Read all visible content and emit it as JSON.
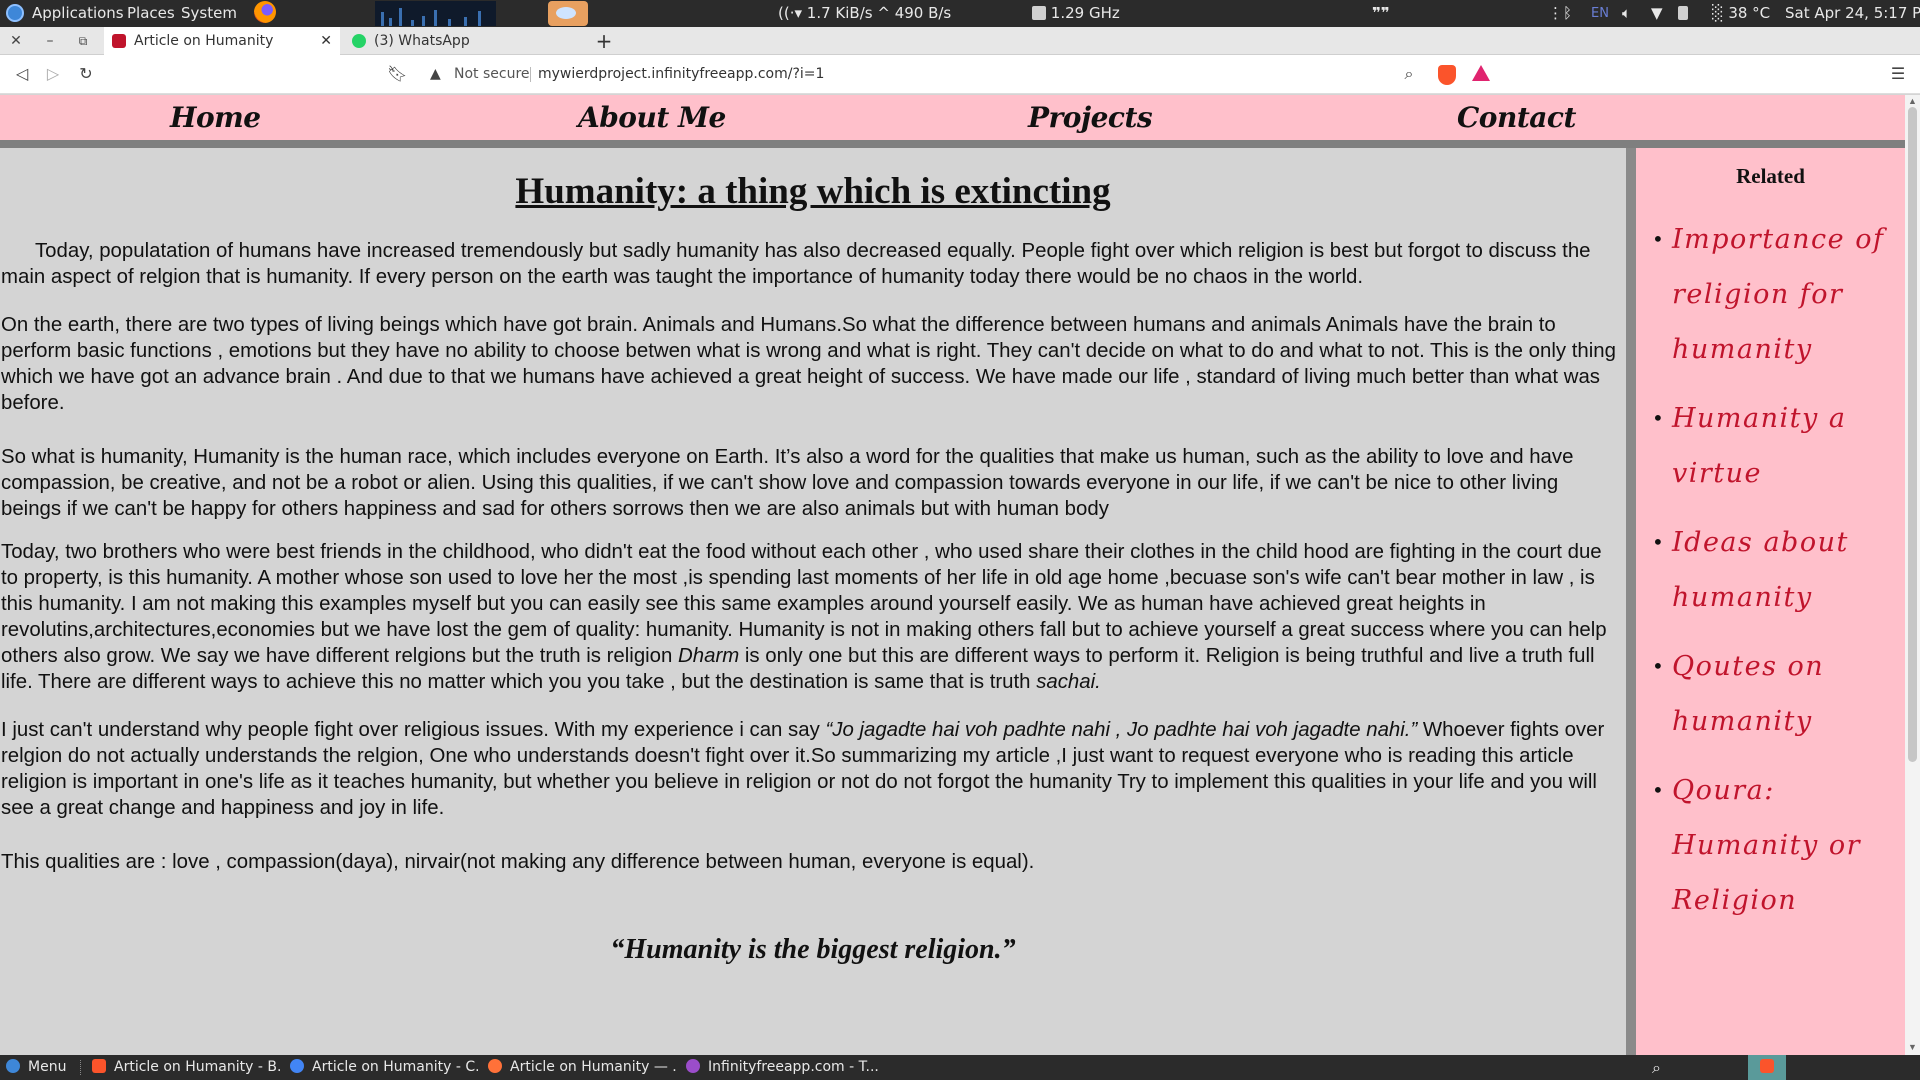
{
  "system_panel": {
    "menu_applications": "Applications",
    "menu_places": "Places",
    "menu_system": "System",
    "net_speed": "1.7 KiB/s ^ 490 B/s",
    "cpu_freq": "1.29 GHz",
    "keyboard_layout": "EN",
    "temperature": "38 °C",
    "clock": "Sat Apr 24,  5:17 PM"
  },
  "browser": {
    "tabs": [
      {
        "label": "Article on Humanity",
        "active": true,
        "favicon_color": "#c0142c"
      },
      {
        "label": "(3) WhatsApp",
        "active": false,
        "favicon_color": "#25d366"
      }
    ],
    "new_tab_label": "+",
    "security_label": "Not secure",
    "url": "mywierdproject.infinityfreeapp.com/?i=1"
  },
  "site_nav": {
    "items": [
      "Home",
      "About Me",
      "Projects",
      "Contact"
    ]
  },
  "article": {
    "title": "Humanity: a thing which is extincting",
    "paragraphs": [
      {
        "text": "      Today, populatation of humans have increased tremendously but sadly humanity has also decreased equally. People fight over which religion is best but forgot to discuss the main aspect of relgion that is humanity. If every person on the earth was taught the importance of humanity today there would be no chaos in the world."
      },
      {
        "text": "On the earth, there are two types of living beings which have got brain. Animals and Humans.So what the difference between humans and animals Animals have the brain to perform basic functions , emotions but they have no ability to choose betwen what is wrong and what is right. They can't decide on what to do and what to not. This is the only thing which we have got an advance brain . And due to that we humans have achieved a great height of success. We have made our life , standard of living much better than what was before."
      },
      {
        "text": "So what is humanity, Humanity is the human race, which includes everyone on Earth. It’s also a word for the qualities that make us human, such as the ability to love and have compassion, be creative, and not be a robot or alien. Using this qualities, if we can't show love and compassion towards everyone in our life, if we can't be nice to other living beings if we can't be happy for others happiness and sad for others sorrows then we are also animals but with human body"
      },
      {
        "part1": "Today, two brothers who were best friends in the childhood, who didn't eat the food without each other , who used share their clothes in the child hood are fighting in the court due to property, is this humanity. A mother whose son used to love her the most ,is spending last moments of her life in old age home ,becuase son's wife can't bear mother in law , is this humanity. I am not making this examples myself but you can easily see this same examples around yourself easily. We as human have achieved great heights in revolutins,architectures,economies but we have lost the gem of quality: humanity. Humanity is not in making others fall but to achieve yourself a great success where you can help others also grow. We say we have different relgions but the truth is religion ",
        "em1": "Dharm",
        "part2": " is only one but this are different ways to perform it. Religion is being truthful and live a truth full life. There are different ways to achieve this no matter which you you take , but the destination is same that is truth ",
        "em2": "sachai."
      },
      {
        "part1": "I just can't understand why people fight over religious issues. With my experience i can say ",
        "em1": "“Jo jagadte hai voh padhte nahi , Jo padhte hai voh jagadte nahi.”",
        "part2": " Whoever fights over relgion do not actually understands the relgion, One who understands doesn't fight over it.So summarizing my article ,I just want to request everyone who is reading this article religion is important in one's life as it teaches humanity, but whether you believe in religion or not do not forgot the humanity Try to implement this qualities in your life and you will see a great change and happiness and joy in life."
      },
      {
        "text": "This qualities are : love , compassion(daya), nirvair(not making any difference between human, everyone is equal)."
      }
    ],
    "closing_quote": "“Humanity is the biggest religion.”"
  },
  "related": {
    "title": "Related",
    "items": [
      "Importance of religion for humanity",
      "Humanity a virtue",
      "Ideas about humanity",
      "Qoutes on humanity",
      "Qoura: Humanity or Religion"
    ]
  },
  "taskbar": {
    "menu_label": "Menu",
    "windows": [
      {
        "label": "Article on Humanity - B...",
        "icon_color": "#fb542b"
      },
      {
        "label": "Article on Humanity - C...",
        "icon_color": "#4285f4"
      },
      {
        "label": "Article on Humanity — ...",
        "icon_color": "#ff7139"
      },
      {
        "label": "Infinityfreeapp.com - T...",
        "icon_color": "#9b4dca"
      }
    ]
  },
  "colors": {
    "nav_bg": "#ffc0cb",
    "page_bg": "#d4d4d4",
    "related_link": "#c0142c"
  }
}
